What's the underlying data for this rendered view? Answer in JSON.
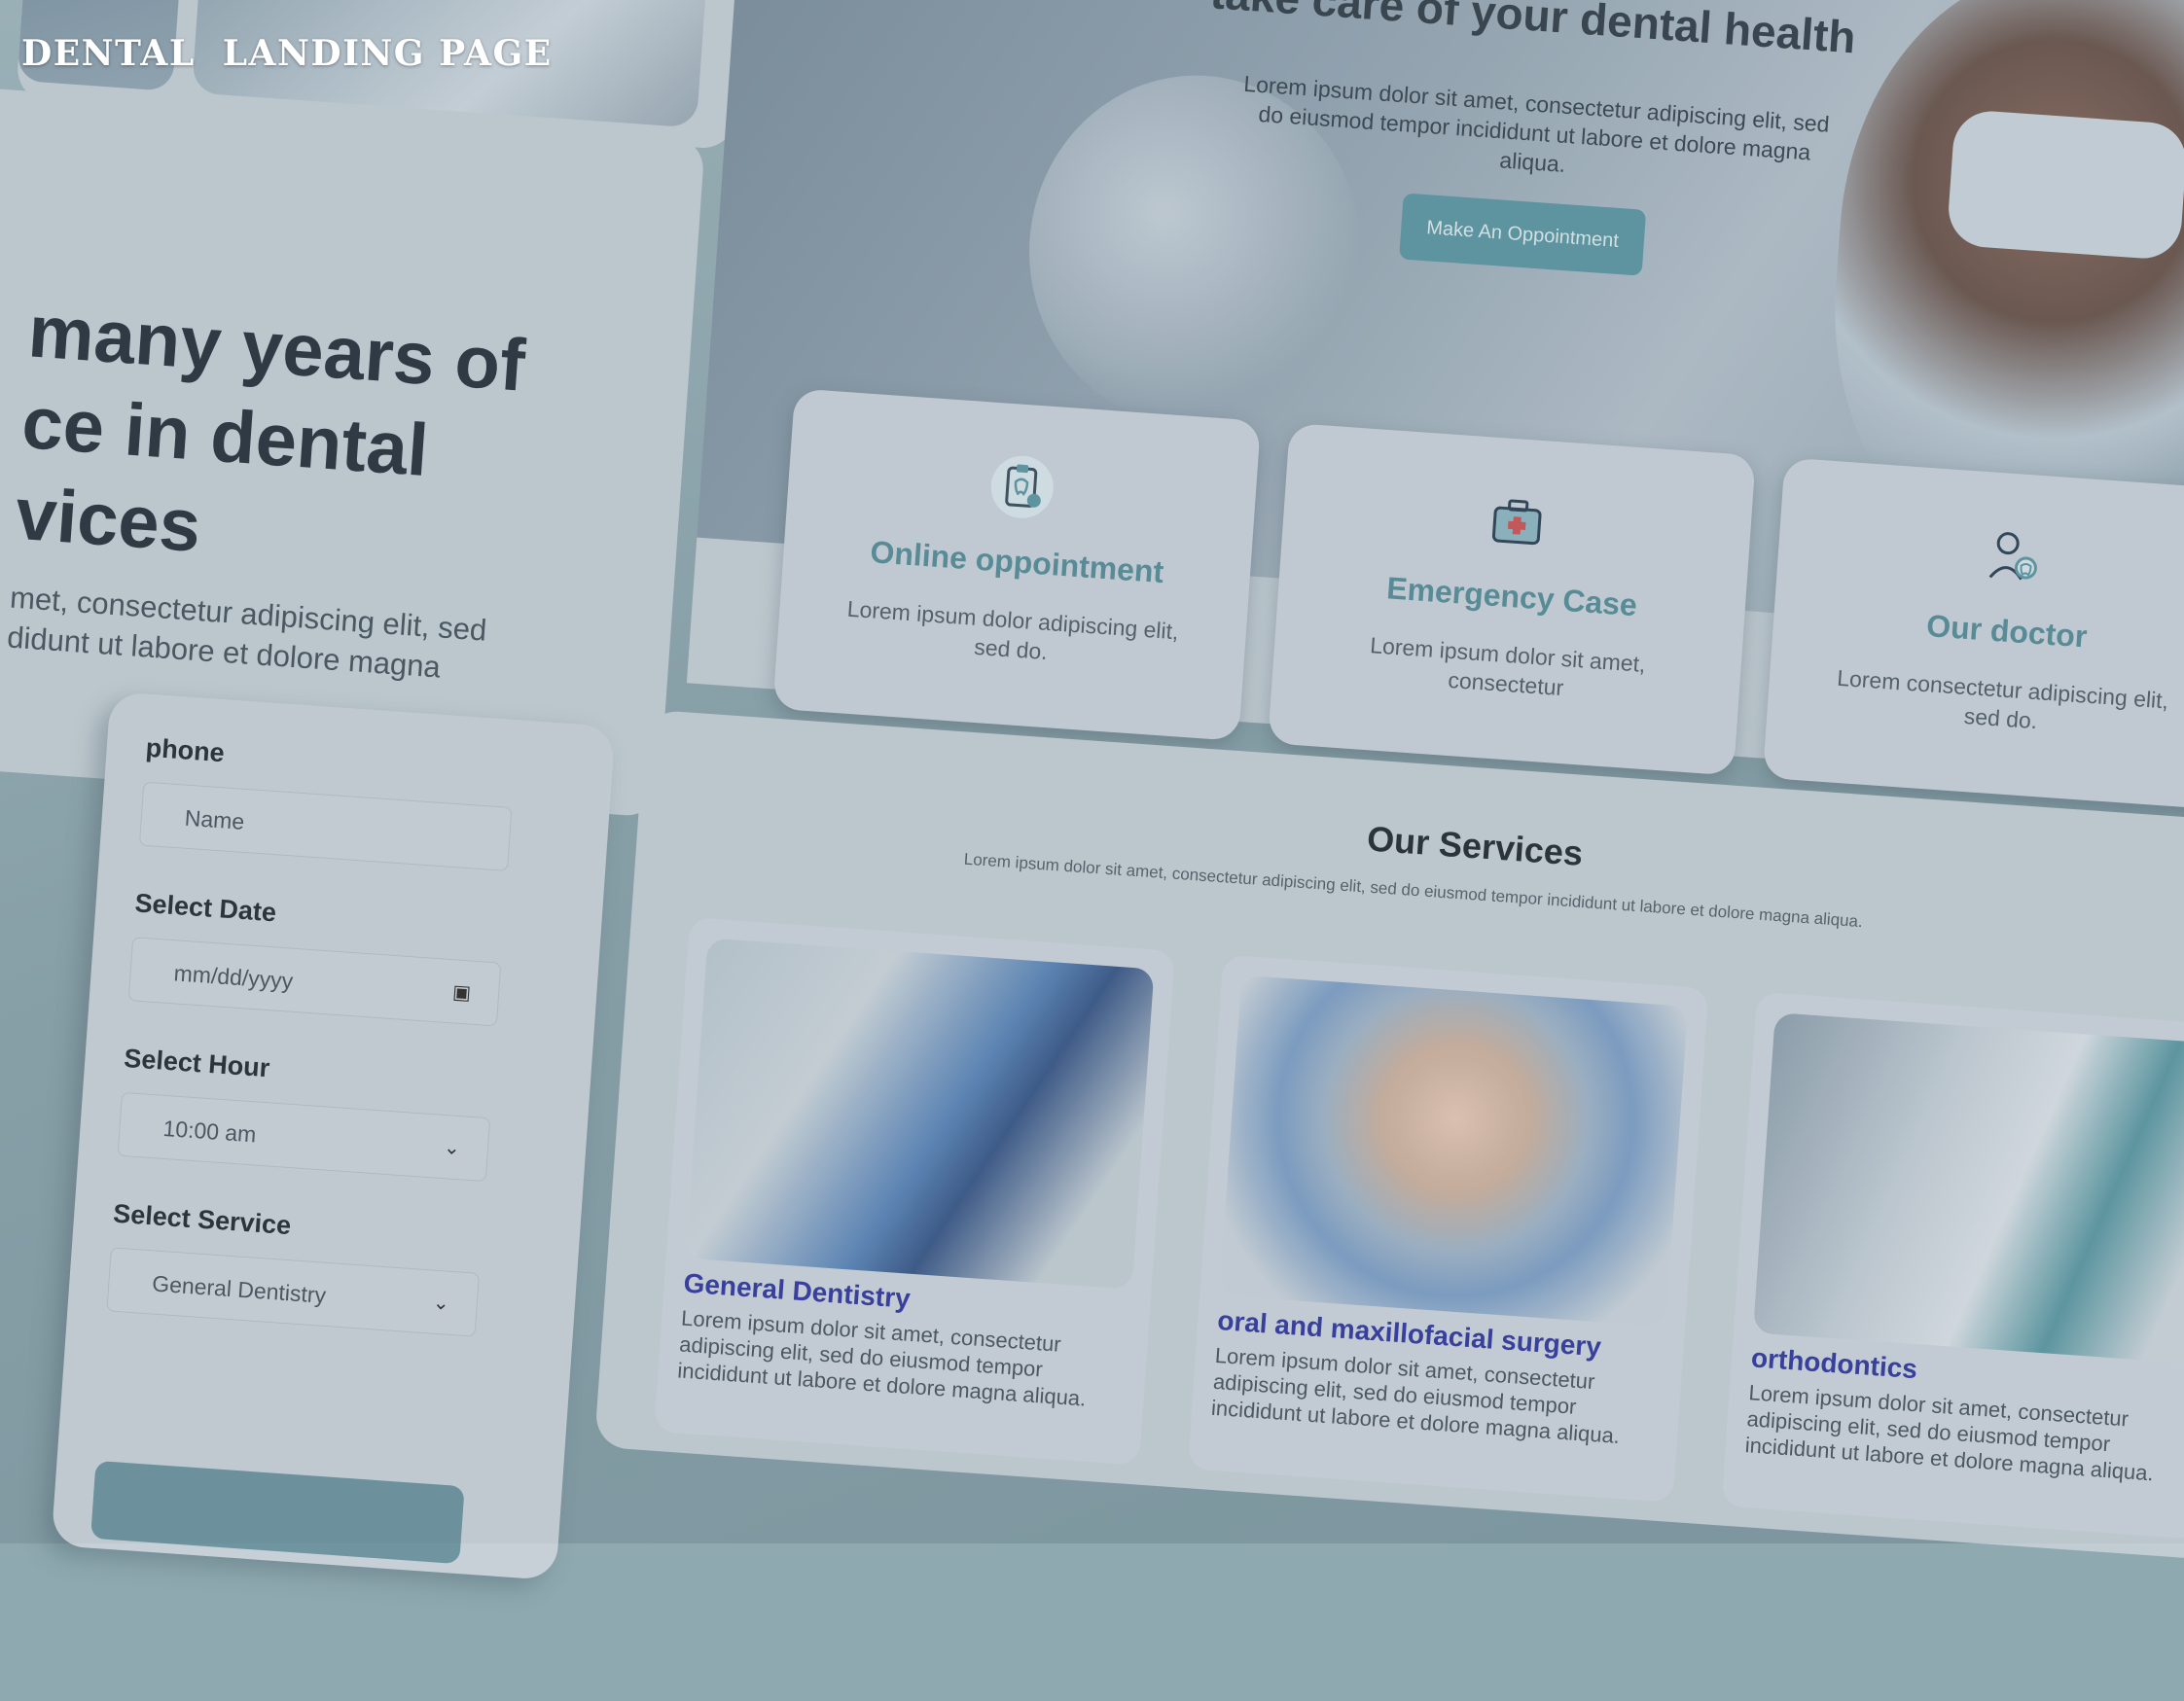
{
  "page_title": "DENTAL  LANDING PAGE",
  "hero": {
    "heading": "many years of\nce in dental\nvices",
    "text": "met, consectetur adipiscing elit, sed\ndidunt ut labore et dolore magna"
  },
  "form": {
    "phone_label": "phone",
    "name_placeholder": "Name",
    "date_label": "Select Date",
    "date_placeholder": "mm/dd/yyyy",
    "hour_label": "Select Hour",
    "hour_value": "10:00 am",
    "service_label": "Select Service",
    "service_value": "General Dentistry"
  },
  "banner": {
    "heading": "e ready to help you and\ntake care of your dental health",
    "text": "Lorem ipsum dolor sit amet, consectetur adipiscing elit, sed do eiusmod tempor incididunt ut labore et dolore magna aliqua.",
    "button_label": "Make An Oppointment"
  },
  "features": [
    {
      "title": "Online oppointment",
      "text": "Lorem ipsum dolor adipiscing elit, sed do.",
      "icon": "clipboard-tooth-icon"
    },
    {
      "title": "Emergency Case",
      "text": "Lorem ipsum dolor sit amet, consectetur",
      "icon": "first-aid-kit-icon"
    },
    {
      "title": "Our doctor",
      "text": "Lorem consectetur adipiscing elit, sed do.",
      "icon": "doctor-icon"
    }
  ],
  "services": {
    "title": "Our Services",
    "subtitle": "Lorem ipsum dolor sit amet, consectetur adipiscing elit, sed do eiusmod tempor incididunt ut labore et dolore magna aliqua.",
    "items": [
      {
        "name": "General Dentistry",
        "text": "Lorem ipsum dolor sit amet, consectetur adipiscing elit, sed do eiusmod tempor incididunt ut labore et dolore magna aliqua."
      },
      {
        "name": "oral and maxillofacial surgery",
        "text": "Lorem ipsum dolor sit amet, consectetur adipiscing elit, sed do eiusmod tempor incididunt ut labore et dolore magna aliqua."
      },
      {
        "name": "orthodontics",
        "text": "Lorem ipsum dolor sit amet, consectetur adipiscing elit, sed do eiusmod tempor incididunt ut labore et dolore magna aliqua."
      }
    ]
  },
  "colors": {
    "accent": "#5f98a4",
    "service_link": "#3a41a0",
    "background": "#8ea9b0"
  }
}
